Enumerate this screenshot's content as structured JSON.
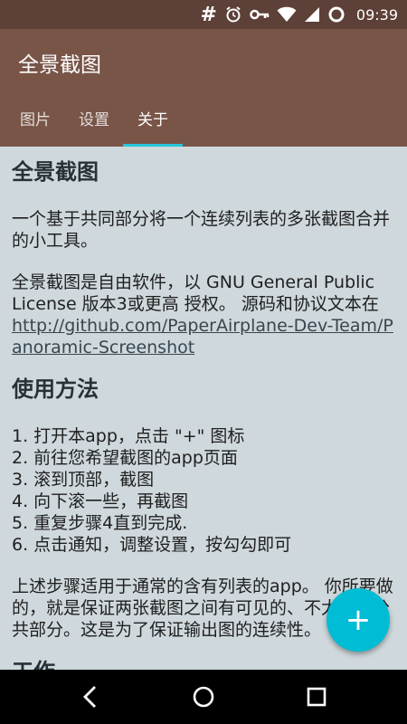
{
  "status_bar": {
    "icons": [
      "hash-icon",
      "alarm-icon",
      "key-icon",
      "wifi-icon",
      "signal-icon",
      "sync-icon"
    ],
    "hash_glyph": "#",
    "time": "09:39"
  },
  "app_bar": {
    "title": "全景截图",
    "background": "#795548",
    "tabs": [
      {
        "label": "图片",
        "active": false
      },
      {
        "label": "设置",
        "active": false
      },
      {
        "label": "关于",
        "active": true
      }
    ],
    "indicator_color": "#26c6da"
  },
  "about": {
    "heading1": "全景截图",
    "intro": "一个基于共同部分将一个连续列表的多张截图合并的小工具。",
    "license_text": "全景截图是自由软件，以 GNU General Public License 版本3或更高 授权。 源码和协议文本在",
    "license_link": "http://github.com/PaperAirplane-Dev-Team/Panoramic-Screenshot",
    "heading2": "使用方法",
    "steps": [
      "1. 打开本app，点击 \"+\" 图标",
      "2. 前往您希望截图的app页面",
      "3. 滚到顶部，截图",
      "4. 向下滚一些，再截图",
      "5. 重复步骤4直到完成.",
      "6. 点击通知，调整设置，按勾勾即可"
    ],
    "note": "上述步骤适用于通常的含有列表的app。 你所要做的，就是保证两张截图之间有可见的、不太小的公共部分。这是为了保证输出图的连续性。",
    "heading3": "工作"
  },
  "fab": {
    "icon": "plus-icon",
    "glyph": "+",
    "color": "#00bcd4"
  },
  "nav_bar": {
    "buttons": [
      "back-icon",
      "home-icon",
      "recents-icon"
    ]
  }
}
